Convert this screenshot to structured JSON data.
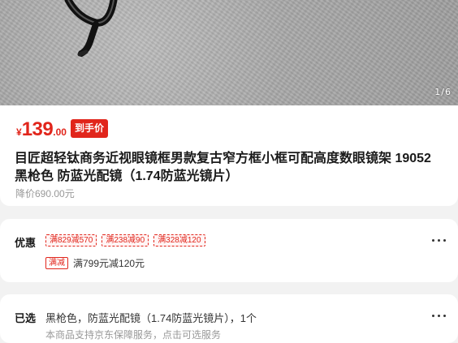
{
  "gallery": {
    "image_desc_icon": "eyeglasses-product-photo",
    "counter": "1/6"
  },
  "price": {
    "currency": "¥",
    "integer": "139",
    "decimal": ".00",
    "tag": "到手价",
    "color": "#e1251b"
  },
  "product": {
    "title": "目匠超轻钛商务近视眼镜框男款复古窄方框小框可配高度数眼镜架 19052 黑枪色 防蓝光配镜（1.74防蓝光镜片）",
    "original_price": "降价690.00元"
  },
  "promotions": {
    "label": "优惠",
    "coupons": [
      "满829减570",
      "满238减90",
      "满328减120"
    ],
    "promo_badge": "满减",
    "promo_text": "满799元减120元"
  },
  "selection": {
    "label": "已选",
    "text": "黑枪色，防蓝光配镜（1.74防蓝光镜片），1个",
    "sub": "本商品支持京东保障服务，点击可选服务"
  }
}
